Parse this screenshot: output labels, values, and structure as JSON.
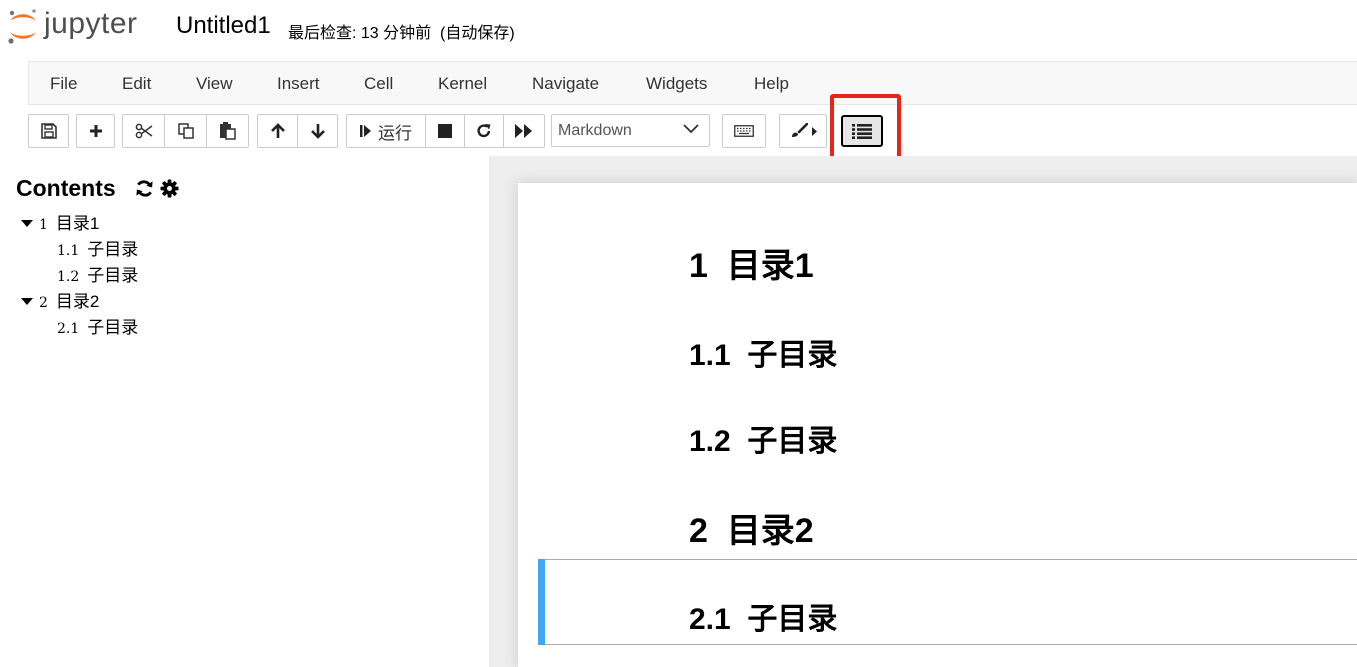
{
  "header": {
    "logo_text": "jupyter",
    "notebook_name": "Untitled1",
    "checkpoint_status": "最后检查: 13 分钟前  (自动保存)"
  },
  "menu": [
    "File",
    "Edit",
    "View",
    "Insert",
    "Cell",
    "Kernel",
    "Navigate",
    "Widgets",
    "Help"
  ],
  "toolbar": {
    "run_label": "运行",
    "cell_type": "Markdown",
    "icons": [
      "save-icon",
      "plus-icon",
      "cut-icon",
      "copy-icon",
      "paste-icon",
      "arrow-up-icon",
      "arrow-down-icon",
      "step-forward-icon",
      "stop-icon",
      "refresh-icon",
      "fast-forward-icon",
      "keyboard-icon",
      "paint-brush-icon",
      "list-icon"
    ]
  },
  "toc": {
    "title": "Contents",
    "entries": [
      {
        "num": "1",
        "text": "目录1"
      },
      {
        "num": "1.1",
        "text": "子目录"
      },
      {
        "num": "1.2",
        "text": "子目录"
      },
      {
        "num": "2",
        "text": "目录2"
      },
      {
        "num": "2.1",
        "text": "子目录"
      }
    ]
  },
  "notebook": {
    "headings": [
      {
        "text": "1  目录1"
      },
      {
        "text": "1.1  子目录"
      },
      {
        "text": "1.2  子目录"
      },
      {
        "text": "2  目录2"
      },
      {
        "text": "2.1  子目录"
      }
    ]
  },
  "colors": {
    "highlight": "#e8251a",
    "selected_cell_bar": "#42a5f5",
    "logo_orange": "#f37726"
  }
}
